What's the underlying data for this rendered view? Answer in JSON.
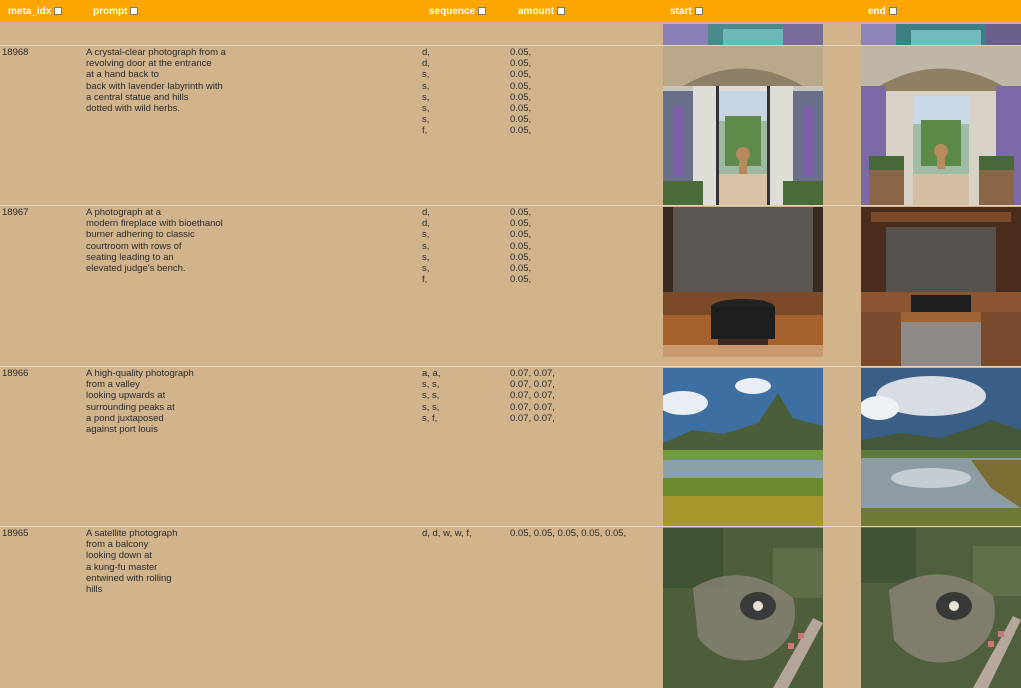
{
  "header": {
    "meta_idx": "meta_idx",
    "prompt": "prompt",
    "sequence": "sequence",
    "amount": "amount",
    "start": "start",
    "end": "end"
  },
  "rows": [
    {
      "meta_idx": "18968",
      "prompt": "A crystal-clear photograph from a\nrevolving door at the entrance\nat a hand back to\nback with lavender labyrinth with\na central statue and hills\ndotted with wild herbs.",
      "sequence": "d,\nd,\ns,\ns,\ns,\ns,\ns,\nf,",
      "amount": "0.05,\n0.05,\n0.05,\n0.05,\n0.05,\n0.05,\n0.05,\n0.05,"
    },
    {
      "meta_idx": "18967",
      "prompt": "A photograph at a\nmodern fireplace with bioethanol\nburner adhering to classic\ncourtroom with rows of\nseating leading to an\nelevated judge's bench.",
      "sequence": "d,\nd,\ns,\ns,\ns,\ns,\nf,",
      "amount": "0.05,\n0.05,\n0.05,\n0.05,\n0.05,\n0.05,\n0.05,"
    },
    {
      "meta_idx": "18966",
      "prompt": "A high-quality photograph\nfrom a valley\nlooking upwards at\nsurrounding peaks at\na pond juxtaposed\nagainst port louis",
      "sequence": "a, a,\ns, s,\ns, s,\ns, s,\ns, f,",
      "amount": "0.07, 0.07,\n0.07, 0.07,\n0.07, 0.07,\n0.07, 0.07,\n0.07, 0.07,"
    },
    {
      "meta_idx": "18965",
      "prompt": "A satellite photograph\nfrom a balcony\nlooking down at\na kung-fu master\nentwined with rolling\nhills",
      "sequence": "d, d, w, w, f,",
      "amount": "0.05, 0.05, 0.05, 0.05, 0.05,"
    }
  ],
  "colors": {
    "header_bg": "#ffa500",
    "page_bg": "#d2b48c"
  }
}
